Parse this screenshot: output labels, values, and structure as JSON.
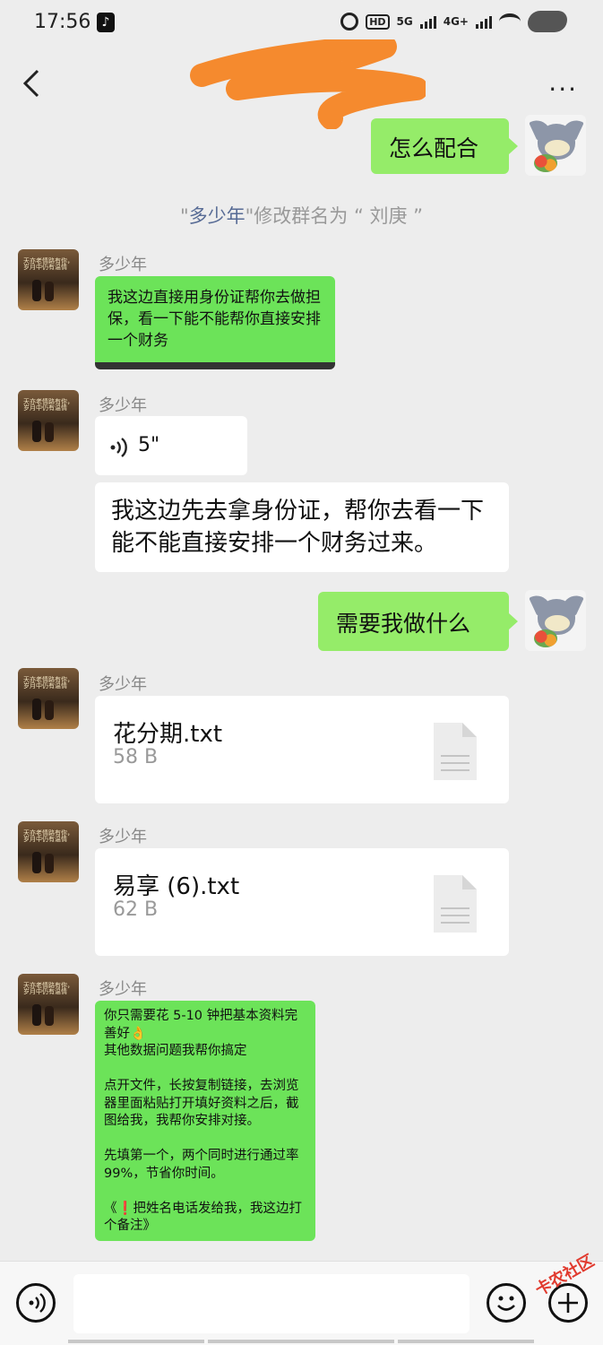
{
  "status": {
    "time": "17:56",
    "hd_label": "HD",
    "net1": "5G",
    "net2": "4G+"
  },
  "header": {
    "more_label": "..."
  },
  "messages": {
    "m1_text": "怎么配合",
    "system_prefix": "\"",
    "system_name": "多少年",
    "system_suffix": "\"修改群名为 “ 刘庚 ”",
    "m2_sender": "多少年",
    "m2_text": "我这边直接用身份证帮你去做担保，看一下能不能帮你直接安排一个财务",
    "m3_sender": "多少年",
    "m3_voice_duration": "5\"",
    "m3_transcript": "我这边先去拿身份证，帮你去看一下能不能直接安排一个财务过来。",
    "m4_text": "需要我做什么",
    "m5_sender": "多少年",
    "m5_file_name": "花分期.txt",
    "m5_file_size": "58 B",
    "m6_sender": "多少年",
    "m6_file_name": "易享 (6).txt",
    "m6_file_size": "62 B",
    "m7_sender": "多少年",
    "m7_text": "你只需要花 5-10 钟把基本资料完善好👌\n其他数据问题我帮你搞定\n\n点开文件，长按复制链接，去浏览器里面粘贴打开填好资料之后，截图给我，我帮你安排对接。\n\n先填第一个，两个同时进行通过率99%，节省你时间。\n\n《❗把姓名电话发给我，我这边打个备注》"
  },
  "watermark": "卡农社区",
  "avatar_text": "天亦老情路有你，岁月中仍有温情"
}
